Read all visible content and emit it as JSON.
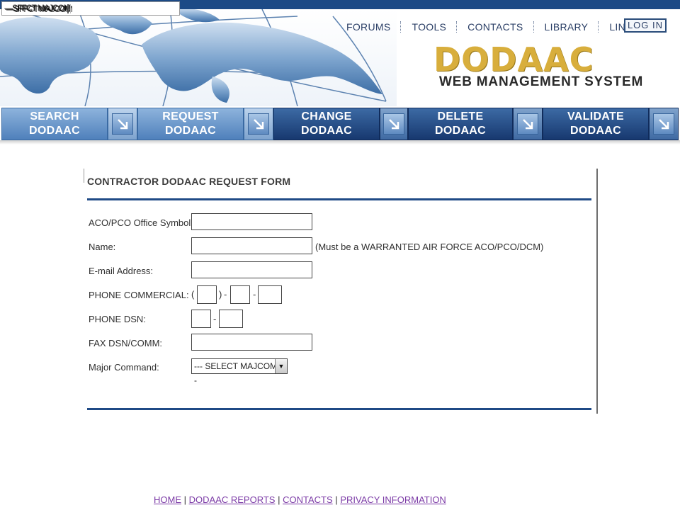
{
  "top_select": {
    "garbled_text": "—SFFCT MAJCOM"
  },
  "header": {
    "nav": [
      {
        "label": "FORUMS"
      },
      {
        "label": "TOOLS"
      },
      {
        "label": "CONTACTS"
      },
      {
        "label": "LIBRARY"
      },
      {
        "label": "LINKS"
      }
    ],
    "login_label": "LOG IN",
    "logo_text": "DODAAC",
    "logo_sub": "WEB MANAGEMENT SYSTEM"
  },
  "menu": [
    {
      "line1": "SEARCH",
      "line2": "DODAAC"
    },
    {
      "line1": "REQUEST",
      "line2": "DODAAC"
    },
    {
      "line1": "CHANGE",
      "line2": "DODAAC"
    },
    {
      "line1": "DELETE",
      "line2": "DODAAC"
    },
    {
      "line1": "VALIDATE",
      "line2": "DODAAC"
    }
  ],
  "form": {
    "title": "CONTRACTOR DODAAC REQUEST FORM",
    "aco_label": "ACO/PCO Office Symbol:",
    "name_label": "Name:",
    "name_note": "(Must be a WARRANTED AIR FORCE ACO/PCO/DCM)",
    "email_label": "E-mail Address:",
    "phone_comm_label": "PHONE COMMERCIAL:",
    "phone_dsn_label": "PHONE DSN:",
    "fax_label": "FAX DSN/COMM:",
    "majcom_label": "Major Command:",
    "majcom_selected": "--- SELECT MAJCOM ---",
    "paren_open": "(",
    "paren_close": ")",
    "dash": "-"
  },
  "footer": {
    "links": [
      "HOME",
      "DODAAC REPORTS",
      "CONTACTS",
      "PRIVACY INFORMATION"
    ],
    "sep": "|"
  }
}
